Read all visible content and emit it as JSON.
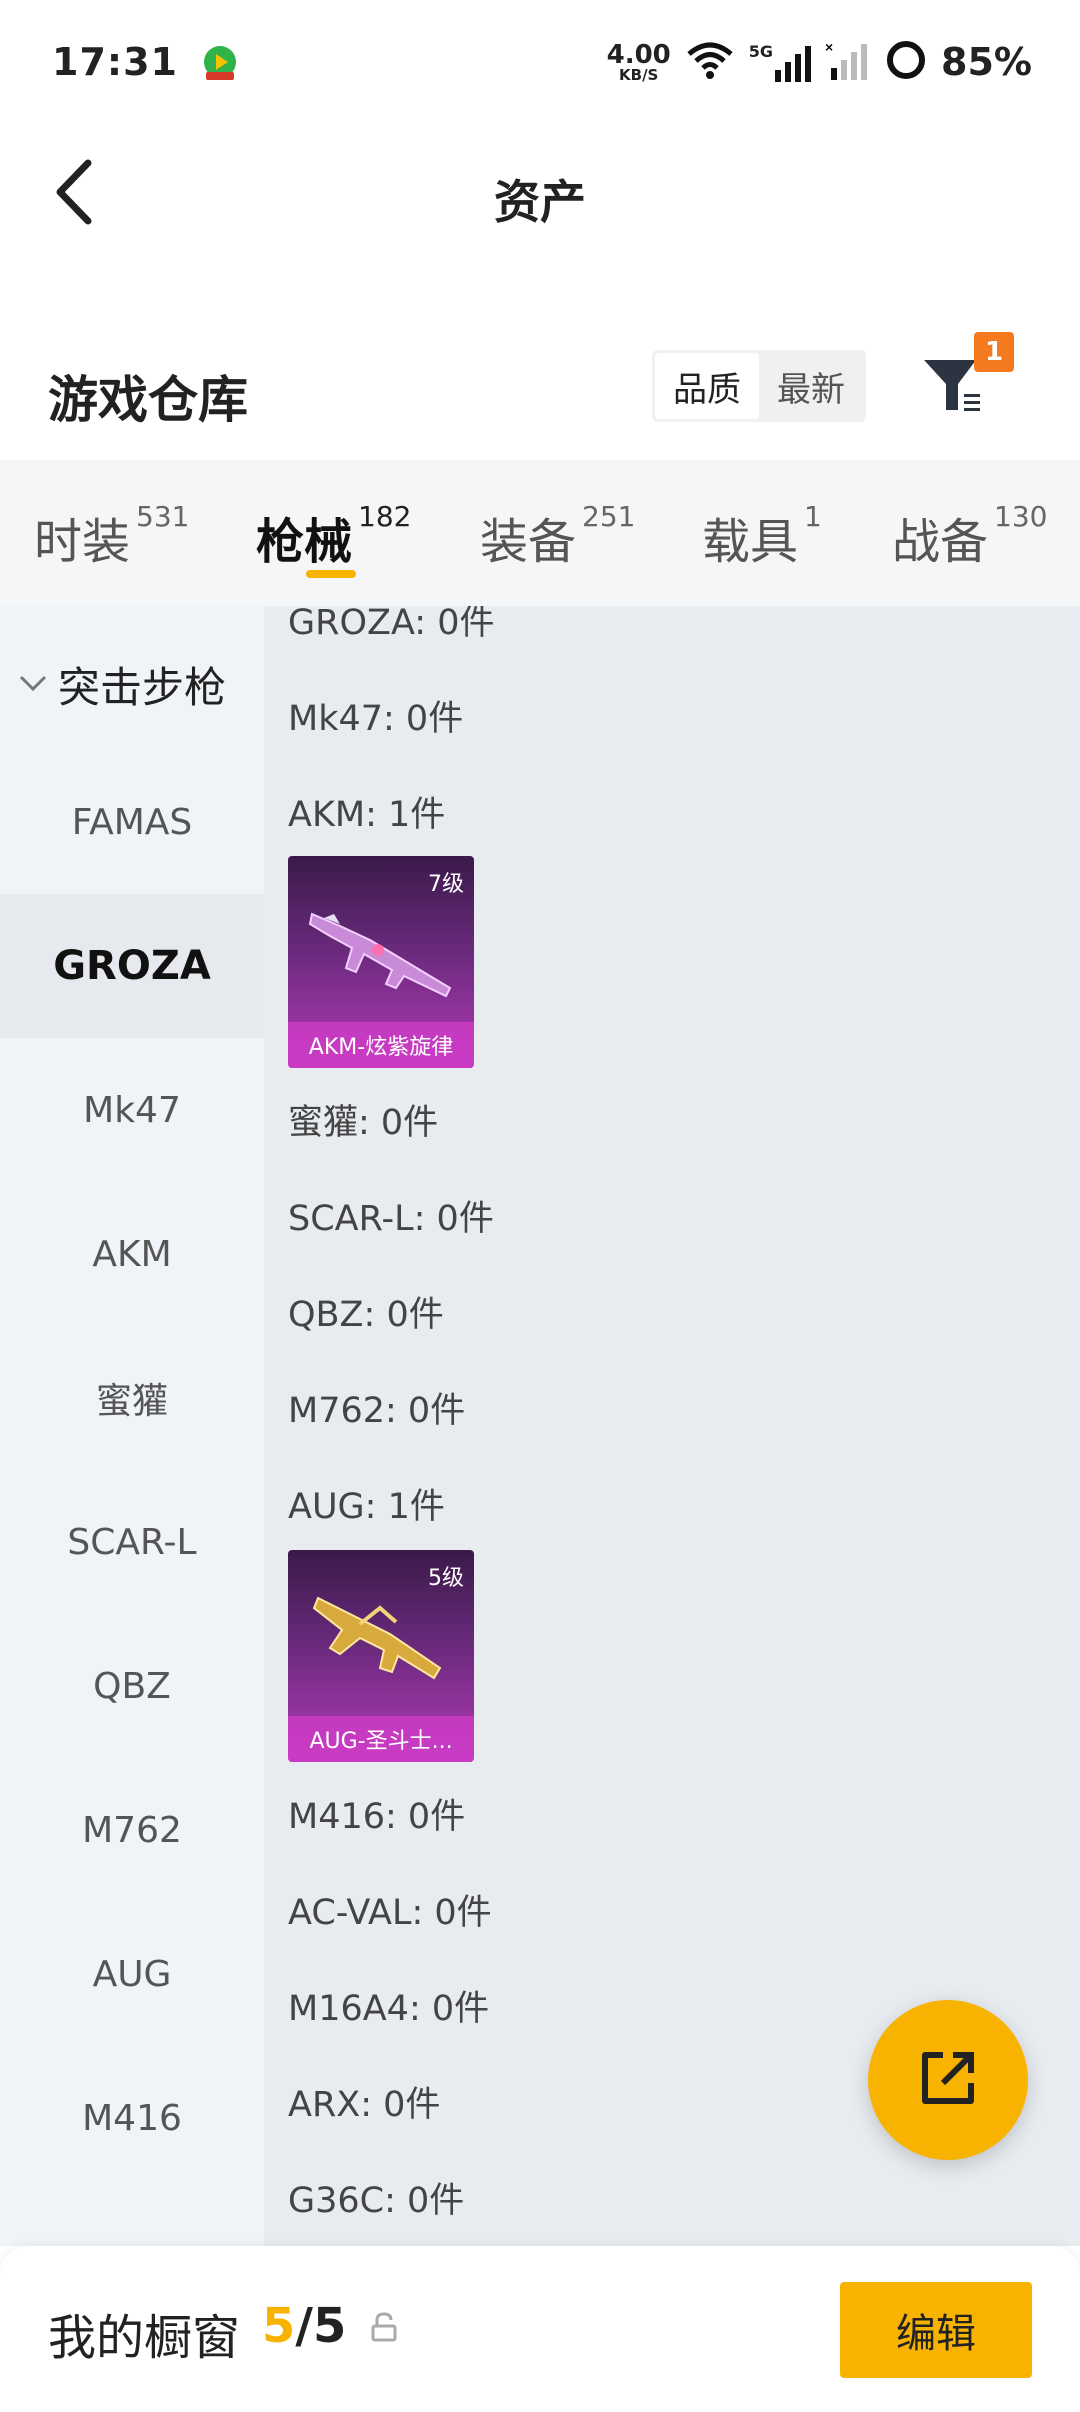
{
  "status_bar": {
    "time": "17:31",
    "net_speed_value": "4.00",
    "net_speed_unit": "KB/S",
    "network_type": "5G",
    "battery": "85%"
  },
  "header": {
    "title": "资产",
    "back_icon": "chevron-left-icon"
  },
  "warehouse": {
    "title": "游戏仓库",
    "sort_options": [
      "品质",
      "最新"
    ],
    "sort_selected": "品质",
    "filter_badge": "1"
  },
  "tabs": [
    {
      "label": "时装",
      "count": "531",
      "active": false
    },
    {
      "label": "枪械",
      "count": "182",
      "active": true
    },
    {
      "label": "装备",
      "count": "251",
      "active": false
    },
    {
      "label": "载具",
      "count": "1",
      "active": false
    },
    {
      "label": "战备",
      "count": "130",
      "active": false
    }
  ],
  "sidebar": {
    "group_label": "突击步枪",
    "items": [
      "FAMAS",
      "GROZA",
      "Mk47",
      "AKM",
      "蜜獾",
      "SCAR-L",
      "QBZ",
      "M762",
      "AUG",
      "M416"
    ],
    "active_item": "GROZA"
  },
  "content": {
    "weapons": [
      {
        "label": "GROZA: 0件"
      },
      {
        "label": "Mk47: 0件"
      },
      {
        "label": "AKM: 1件",
        "skin": {
          "level": "7级",
          "name": "AKM-炫紫旋律"
        }
      },
      {
        "label": "蜜獾: 0件"
      },
      {
        "label": "SCAR-L: 0件"
      },
      {
        "label": "QBZ: 0件"
      },
      {
        "label": "M762: 0件"
      },
      {
        "label": "AUG: 1件",
        "skin": {
          "level": "5级",
          "name": "AUG-圣斗士..."
        }
      },
      {
        "label": "M416: 0件"
      },
      {
        "label": "AC-VAL: 0件"
      },
      {
        "label": "M16A4: 0件"
      },
      {
        "label": "ARX: 0件"
      },
      {
        "label": "G36C: 0件"
      }
    ]
  },
  "bottom_bar": {
    "title": "我的橱窗",
    "count_current": "5",
    "count_separator": "/",
    "count_total": "5",
    "edit_label": "编辑"
  },
  "colors": {
    "accent": "#f8b300",
    "badge": "#f47a1f",
    "card_purple": "#b33ab8"
  }
}
